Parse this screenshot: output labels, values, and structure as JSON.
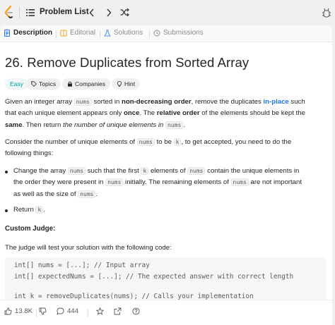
{
  "nav": {
    "problem_list_label": "Problem List"
  },
  "tabs": [
    {
      "label": "Description"
    },
    {
      "label": "Editorial"
    },
    {
      "label": "Solutions"
    },
    {
      "label": "Submissions"
    }
  ],
  "problem": {
    "title": "26. Remove Duplicates from Sorted Array",
    "difficulty": "Easy",
    "chips": [
      "Topics",
      "Companies",
      "Hint"
    ]
  },
  "description": {
    "p1": {
      "t1": "Given an integer array ",
      "c1": "nums",
      "t2": " sorted in ",
      "b1": "non-decreasing order",
      "t3": ", remove the duplicates ",
      "l1": "in-place",
      "t4": " such",
      "t5": "that each unique element appears only ",
      "b2": "once",
      "t6": ". The ",
      "b3": "relative order",
      "t7": " of the elements should be kept the",
      "b4": "same",
      "t8": ". Then return ",
      "i1": "the number of unique elements in",
      "c2": "nums",
      "t9": "."
    },
    "p2": {
      "t1": "Consider the number of unique elements of ",
      "c1": "nums",
      "t2": " to be ",
      "c2": "k",
      "t3": ", to get accepted, you need to do the",
      "t4": "following things:"
    },
    "bullet1": {
      "t1": "Change the array ",
      "c1": "nums",
      "t2": " such that the first ",
      "c2": "k",
      "t3": " elements of ",
      "c3": "nums",
      "t4": " contain the unique elements in",
      "t5": "the order they were present in ",
      "c4": "nums",
      "t6": " initially. The remaining elements of ",
      "c5": "nums",
      "t7": " are not important",
      "t8": "as well as the size of ",
      "c6": "nums",
      "t9": "."
    },
    "bullet2": {
      "t1": "Return ",
      "c1": "k",
      "t2": "."
    },
    "custom_judge_heading": "Custom Judge:",
    "judge_text": "The judge will test your solution with the following code:",
    "code_lines": [
      "int[] nums = [...]; // Input array",
      "int[] expectedNums = [...]; // The expected answer with correct length",
      "",
      "int k = removeDuplicates(nums); // Calls your implementation"
    ]
  },
  "bottom": {
    "likes": "13.8K",
    "comments": "444"
  },
  "colors": {
    "easy": "#00a3a3",
    "link": "#1a73e8",
    "editorial_icon": "#f5a623",
    "solutions_icon": "#4a90e2",
    "description_icon": "#1a73e8"
  }
}
